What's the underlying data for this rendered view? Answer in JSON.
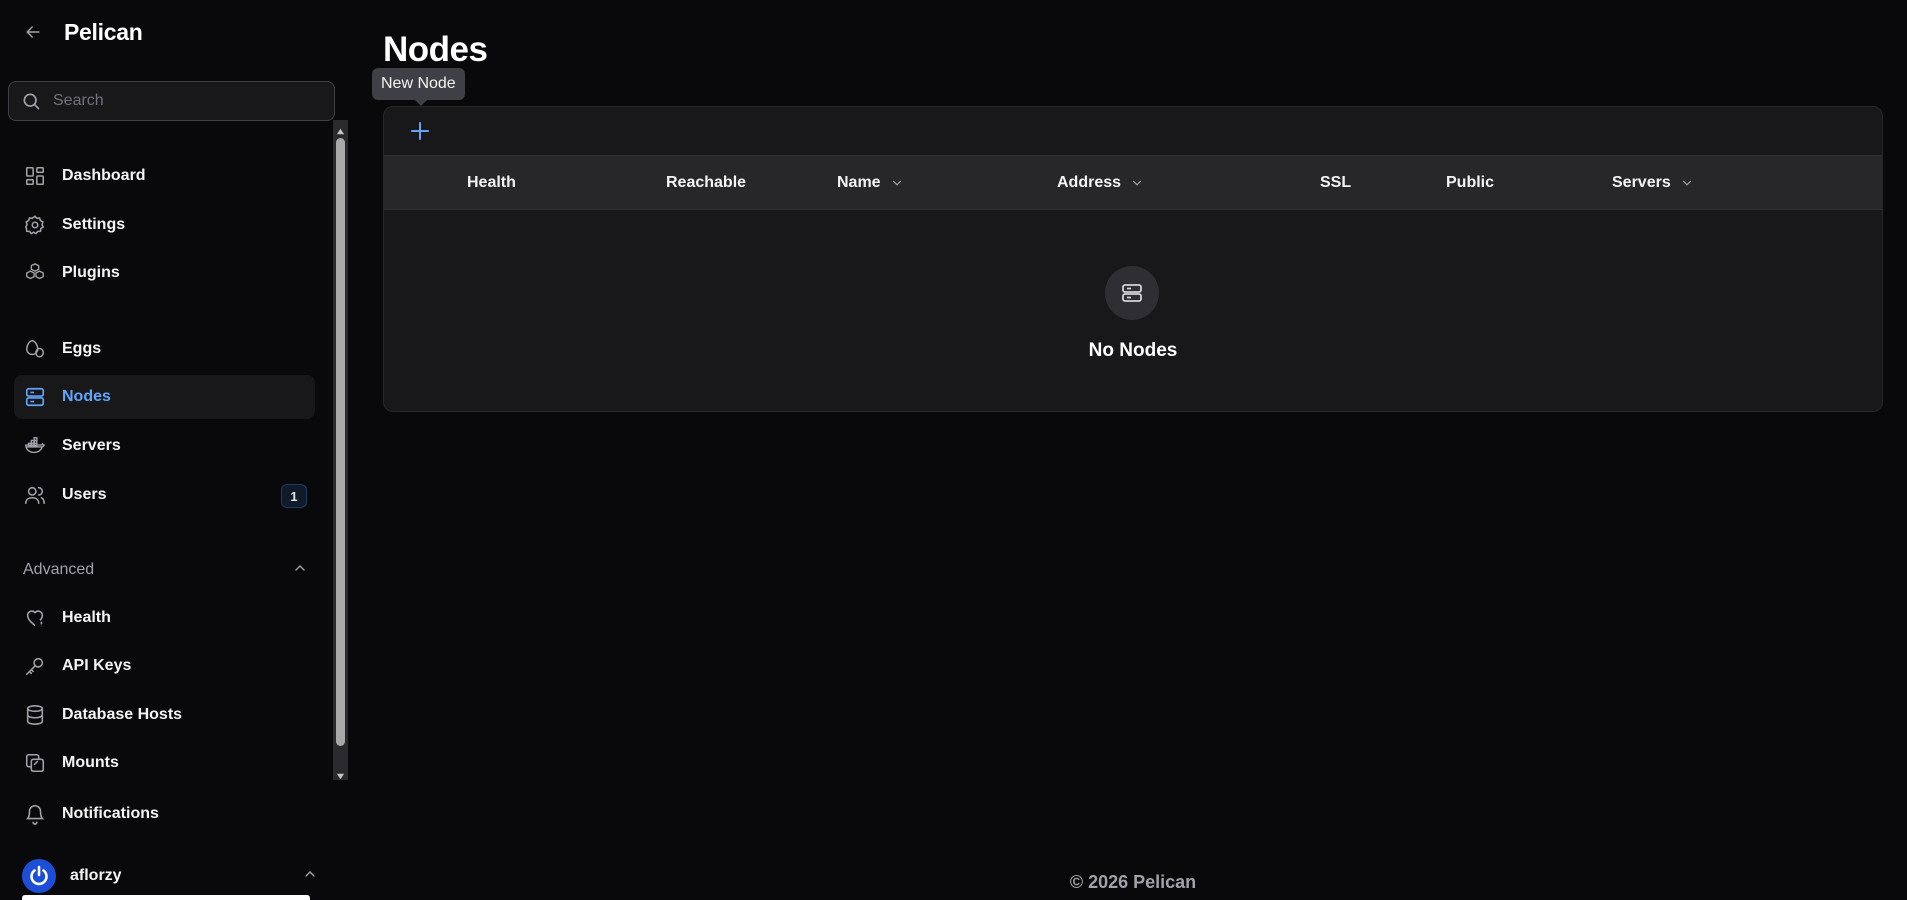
{
  "app": {
    "title": "Pelican"
  },
  "search": {
    "placeholder": "Search",
    "value": ""
  },
  "sidebar": {
    "items": [
      {
        "label": "Dashboard",
        "icon": "dashboard-icon"
      },
      {
        "label": "Settings",
        "icon": "gear-icon"
      },
      {
        "label": "Plugins",
        "icon": "cubes-icon"
      },
      {
        "label": "Eggs",
        "icon": "eggs-icon"
      },
      {
        "label": "Nodes",
        "icon": "server-icon",
        "active": true
      },
      {
        "label": "Servers",
        "icon": "docker-icon"
      },
      {
        "label": "Users",
        "icon": "users-icon",
        "badge": "1"
      }
    ],
    "advanced": {
      "label": "Advanced",
      "items": [
        {
          "label": "Health",
          "icon": "heart-icon"
        },
        {
          "label": "API Keys",
          "icon": "key-icon"
        },
        {
          "label": "Database Hosts",
          "icon": "database-icon"
        },
        {
          "label": "Mounts",
          "icon": "mounts-icon"
        },
        {
          "label": "Notifications",
          "icon": "bell-icon"
        }
      ]
    },
    "user": {
      "name": "aflorzy"
    }
  },
  "main": {
    "title": "Nodes",
    "tooltip": "New Node",
    "table": {
      "columns": [
        {
          "label": "Health",
          "sortable": false
        },
        {
          "label": "Reachable",
          "sortable": false
        },
        {
          "label": "Name",
          "sortable": true
        },
        {
          "label": "Address",
          "sortable": true
        },
        {
          "label": "SSL",
          "sortable": false
        },
        {
          "label": "Public",
          "sortable": false
        },
        {
          "label": "Servers",
          "sortable": true
        }
      ],
      "rows": [],
      "empty_text": "No Nodes"
    }
  },
  "footer": {
    "text": "© 2026 Pelican"
  },
  "colors": {
    "accent": "#60a5fa",
    "background": "#09090b",
    "card": "#18181b"
  }
}
